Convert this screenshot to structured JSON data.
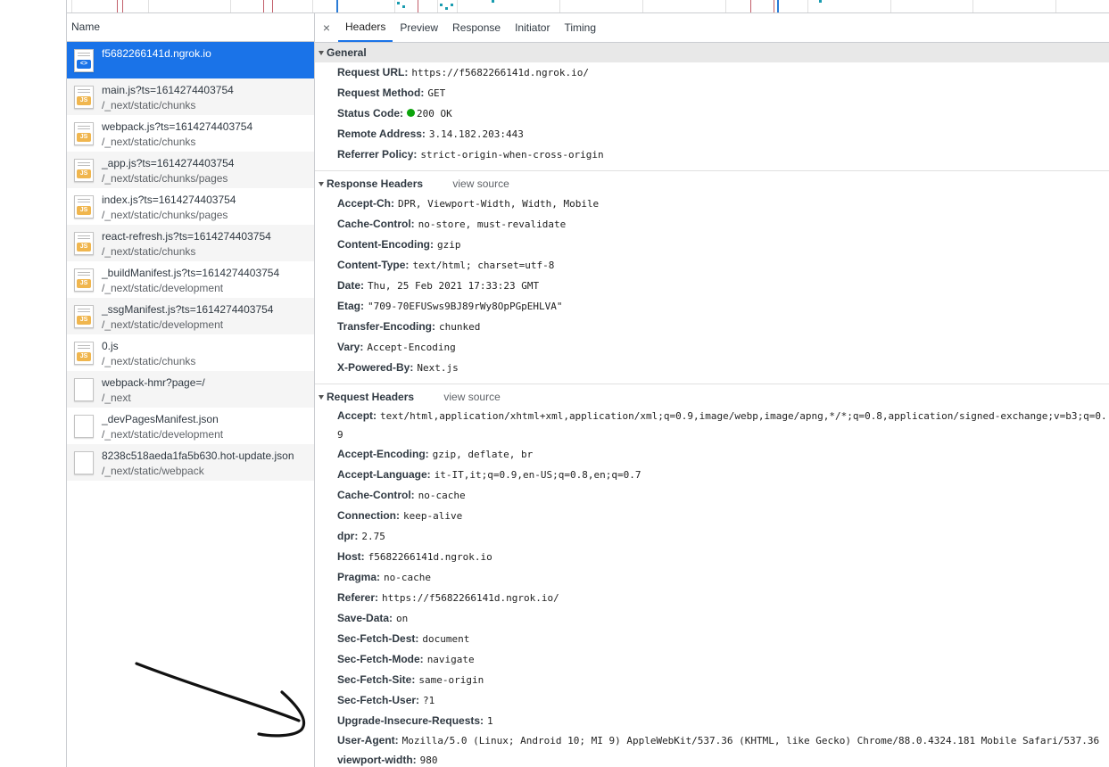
{
  "list": {
    "header": "Name",
    "requests": [
      {
        "name": "f5682266141d.ngrok.io",
        "path": "",
        "type": "doc",
        "badge": "<>"
      },
      {
        "name": "main.js?ts=1614274403754",
        "path": "/_next/static/chunks",
        "type": "js",
        "badge": "JS"
      },
      {
        "name": "webpack.js?ts=1614274403754",
        "path": "/_next/static/chunks",
        "type": "js",
        "badge": "JS"
      },
      {
        "name": "_app.js?ts=1614274403754",
        "path": "/_next/static/chunks/pages",
        "type": "js",
        "badge": "JS"
      },
      {
        "name": "index.js?ts=1614274403754",
        "path": "/_next/static/chunks/pages",
        "type": "js",
        "badge": "JS"
      },
      {
        "name": "react-refresh.js?ts=1614274403754",
        "path": "/_next/static/chunks",
        "type": "js",
        "badge": "JS"
      },
      {
        "name": "_buildManifest.js?ts=1614274403754",
        "path": "/_next/static/development",
        "type": "js",
        "badge": "JS"
      },
      {
        "name": "_ssgManifest.js?ts=1614274403754",
        "path": "/_next/static/development",
        "type": "js",
        "badge": "JS"
      },
      {
        "name": "0.js",
        "path": "/_next/static/chunks",
        "type": "js",
        "badge": "JS"
      },
      {
        "name": "webpack-hmr?page=/",
        "path": "/_next",
        "type": "plain",
        "badge": ""
      },
      {
        "name": "_devPagesManifest.json",
        "path": "/_next/static/development",
        "type": "plain",
        "badge": ""
      },
      {
        "name": "8238c518aeda1fa5b630.hot-update.json",
        "path": "/_next/static/webpack",
        "type": "plain",
        "badge": ""
      }
    ]
  },
  "tabs": {
    "close": "×",
    "items": [
      "Headers",
      "Preview",
      "Response",
      "Initiator",
      "Timing"
    ],
    "active": "Headers"
  },
  "general": {
    "title": "General",
    "rows": [
      {
        "name": "Request URL:",
        "value": "https://f5682266141d.ngrok.io/"
      },
      {
        "name": "Request Method:",
        "value": "GET"
      },
      {
        "name": "Status Code:",
        "value": "200 OK",
        "status_color": "#0ca40c"
      },
      {
        "name": "Remote Address:",
        "value": "3.14.182.203:443"
      },
      {
        "name": "Referrer Policy:",
        "value": "strict-origin-when-cross-origin"
      }
    ]
  },
  "response_headers": {
    "title": "Response Headers",
    "view_source": "view source",
    "rows": [
      {
        "name": "Accept-Ch:",
        "value": "DPR, Viewport-Width, Width, Mobile"
      },
      {
        "name": "Cache-Control:",
        "value": "no-store, must-revalidate"
      },
      {
        "name": "Content-Encoding:",
        "value": "gzip"
      },
      {
        "name": "Content-Type:",
        "value": "text/html; charset=utf-8"
      },
      {
        "name": "Date:",
        "value": "Thu, 25 Feb 2021 17:33:23 GMT"
      },
      {
        "name": "Etag:",
        "value": "\"709-70EFUSws9BJ89rWy8OpPGpEHLVA\""
      },
      {
        "name": "Transfer-Encoding:",
        "value": "chunked"
      },
      {
        "name": "Vary:",
        "value": "Accept-Encoding"
      },
      {
        "name": "X-Powered-By:",
        "value": "Next.js"
      }
    ]
  },
  "request_headers": {
    "title": "Request Headers",
    "view_source": "view source",
    "rows": [
      {
        "name": "Accept:",
        "value": "text/html,application/xhtml+xml,application/xml;q=0.9,image/webp,image/apng,*/*;q=0.8,application/signed-exchange;v=b3;q=0.9"
      },
      {
        "name": "Accept-Encoding:",
        "value": "gzip, deflate, br"
      },
      {
        "name": "Accept-Language:",
        "value": "it-IT,it;q=0.9,en-US;q=0.8,en;q=0.7"
      },
      {
        "name": "Cache-Control:",
        "value": "no-cache"
      },
      {
        "name": "Connection:",
        "value": "keep-alive"
      },
      {
        "name": "dpr:",
        "value": "2.75"
      },
      {
        "name": "Host:",
        "value": "f5682266141d.ngrok.io"
      },
      {
        "name": "Pragma:",
        "value": "no-cache"
      },
      {
        "name": "Referer:",
        "value": "https://f5682266141d.ngrok.io/"
      },
      {
        "name": "Save-Data:",
        "value": "on"
      },
      {
        "name": "Sec-Fetch-Dest:",
        "value": "document"
      },
      {
        "name": "Sec-Fetch-Mode:",
        "value": "navigate"
      },
      {
        "name": "Sec-Fetch-Site:",
        "value": "same-origin"
      },
      {
        "name": "Sec-Fetch-User:",
        "value": "?1"
      },
      {
        "name": "Upgrade-Insecure-Requests:",
        "value": "1"
      },
      {
        "name": "User-Agent:",
        "value": "Mozilla/5.0 (Linux; Android 10; MI 9) AppleWebKit/537.36 (KHTML, like Gecko) Chrome/88.0.4324.181 Mobile Safari/537.36"
      },
      {
        "name": "viewport-width:",
        "value": "980"
      }
    ]
  },
  "colors": {
    "selected_row": "#1a73e8",
    "js_badge": "#f0b64e",
    "annotation_arrow": "#111111"
  }
}
